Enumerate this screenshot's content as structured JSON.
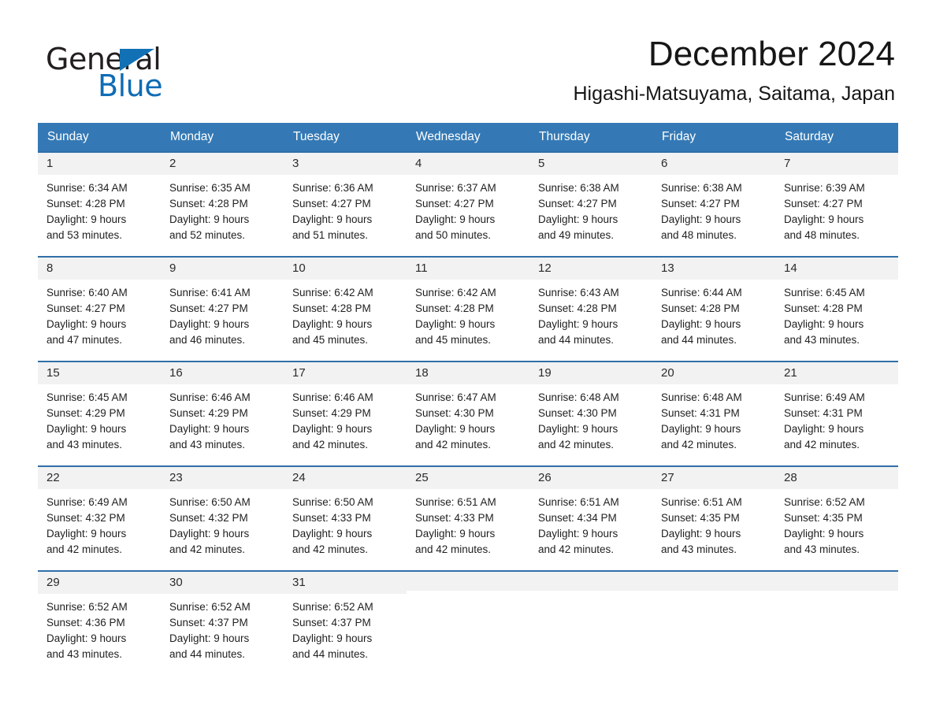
{
  "brand": {
    "name_part1": "General",
    "name_part2": "Blue",
    "triangle_color": "#1271b5",
    "blue_text_color": "#0f6cb5"
  },
  "header": {
    "title": "December 2024",
    "subtitle": "Higashi-Matsuyama, Saitama, Japan"
  },
  "colors": {
    "header_row_bg": "#3479b5",
    "week_divider": "#2f6fa8",
    "day_number_bg": "#f2f2f2"
  },
  "weekdays": [
    "Sunday",
    "Monday",
    "Tuesday",
    "Wednesday",
    "Thursday",
    "Friday",
    "Saturday"
  ],
  "weeks": [
    {
      "days": [
        {
          "num": "1",
          "sunrise": "Sunrise: 6:34 AM",
          "sunset": "Sunset: 4:28 PM",
          "daylight1": "Daylight: 9 hours",
          "daylight2": "and 53 minutes."
        },
        {
          "num": "2",
          "sunrise": "Sunrise: 6:35 AM",
          "sunset": "Sunset: 4:28 PM",
          "daylight1": "Daylight: 9 hours",
          "daylight2": "and 52 minutes."
        },
        {
          "num": "3",
          "sunrise": "Sunrise: 6:36 AM",
          "sunset": "Sunset: 4:27 PM",
          "daylight1": "Daylight: 9 hours",
          "daylight2": "and 51 minutes."
        },
        {
          "num": "4",
          "sunrise": "Sunrise: 6:37 AM",
          "sunset": "Sunset: 4:27 PM",
          "daylight1": "Daylight: 9 hours",
          "daylight2": "and 50 minutes."
        },
        {
          "num": "5",
          "sunrise": "Sunrise: 6:38 AM",
          "sunset": "Sunset: 4:27 PM",
          "daylight1": "Daylight: 9 hours",
          "daylight2": "and 49 minutes."
        },
        {
          "num": "6",
          "sunrise": "Sunrise: 6:38 AM",
          "sunset": "Sunset: 4:27 PM",
          "daylight1": "Daylight: 9 hours",
          "daylight2": "and 48 minutes."
        },
        {
          "num": "7",
          "sunrise": "Sunrise: 6:39 AM",
          "sunset": "Sunset: 4:27 PM",
          "daylight1": "Daylight: 9 hours",
          "daylight2": "and 48 minutes."
        }
      ]
    },
    {
      "days": [
        {
          "num": "8",
          "sunrise": "Sunrise: 6:40 AM",
          "sunset": "Sunset: 4:27 PM",
          "daylight1": "Daylight: 9 hours",
          "daylight2": "and 47 minutes."
        },
        {
          "num": "9",
          "sunrise": "Sunrise: 6:41 AM",
          "sunset": "Sunset: 4:27 PM",
          "daylight1": "Daylight: 9 hours",
          "daylight2": "and 46 minutes."
        },
        {
          "num": "10",
          "sunrise": "Sunrise: 6:42 AM",
          "sunset": "Sunset: 4:28 PM",
          "daylight1": "Daylight: 9 hours",
          "daylight2": "and 45 minutes."
        },
        {
          "num": "11",
          "sunrise": "Sunrise: 6:42 AM",
          "sunset": "Sunset: 4:28 PM",
          "daylight1": "Daylight: 9 hours",
          "daylight2": "and 45 minutes."
        },
        {
          "num": "12",
          "sunrise": "Sunrise: 6:43 AM",
          "sunset": "Sunset: 4:28 PM",
          "daylight1": "Daylight: 9 hours",
          "daylight2": "and 44 minutes."
        },
        {
          "num": "13",
          "sunrise": "Sunrise: 6:44 AM",
          "sunset": "Sunset: 4:28 PM",
          "daylight1": "Daylight: 9 hours",
          "daylight2": "and 44 minutes."
        },
        {
          "num": "14",
          "sunrise": "Sunrise: 6:45 AM",
          "sunset": "Sunset: 4:28 PM",
          "daylight1": "Daylight: 9 hours",
          "daylight2": "and 43 minutes."
        }
      ]
    },
    {
      "days": [
        {
          "num": "15",
          "sunrise": "Sunrise: 6:45 AM",
          "sunset": "Sunset: 4:29 PM",
          "daylight1": "Daylight: 9 hours",
          "daylight2": "and 43 minutes."
        },
        {
          "num": "16",
          "sunrise": "Sunrise: 6:46 AM",
          "sunset": "Sunset: 4:29 PM",
          "daylight1": "Daylight: 9 hours",
          "daylight2": "and 43 minutes."
        },
        {
          "num": "17",
          "sunrise": "Sunrise: 6:46 AM",
          "sunset": "Sunset: 4:29 PM",
          "daylight1": "Daylight: 9 hours",
          "daylight2": "and 42 minutes."
        },
        {
          "num": "18",
          "sunrise": "Sunrise: 6:47 AM",
          "sunset": "Sunset: 4:30 PM",
          "daylight1": "Daylight: 9 hours",
          "daylight2": "and 42 minutes."
        },
        {
          "num": "19",
          "sunrise": "Sunrise: 6:48 AM",
          "sunset": "Sunset: 4:30 PM",
          "daylight1": "Daylight: 9 hours",
          "daylight2": "and 42 minutes."
        },
        {
          "num": "20",
          "sunrise": "Sunrise: 6:48 AM",
          "sunset": "Sunset: 4:31 PM",
          "daylight1": "Daylight: 9 hours",
          "daylight2": "and 42 minutes."
        },
        {
          "num": "21",
          "sunrise": "Sunrise: 6:49 AM",
          "sunset": "Sunset: 4:31 PM",
          "daylight1": "Daylight: 9 hours",
          "daylight2": "and 42 minutes."
        }
      ]
    },
    {
      "days": [
        {
          "num": "22",
          "sunrise": "Sunrise: 6:49 AM",
          "sunset": "Sunset: 4:32 PM",
          "daylight1": "Daylight: 9 hours",
          "daylight2": "and 42 minutes."
        },
        {
          "num": "23",
          "sunrise": "Sunrise: 6:50 AM",
          "sunset": "Sunset: 4:32 PM",
          "daylight1": "Daylight: 9 hours",
          "daylight2": "and 42 minutes."
        },
        {
          "num": "24",
          "sunrise": "Sunrise: 6:50 AM",
          "sunset": "Sunset: 4:33 PM",
          "daylight1": "Daylight: 9 hours",
          "daylight2": "and 42 minutes."
        },
        {
          "num": "25",
          "sunrise": "Sunrise: 6:51 AM",
          "sunset": "Sunset: 4:33 PM",
          "daylight1": "Daylight: 9 hours",
          "daylight2": "and 42 minutes."
        },
        {
          "num": "26",
          "sunrise": "Sunrise: 6:51 AM",
          "sunset": "Sunset: 4:34 PM",
          "daylight1": "Daylight: 9 hours",
          "daylight2": "and 42 minutes."
        },
        {
          "num": "27",
          "sunrise": "Sunrise: 6:51 AM",
          "sunset": "Sunset: 4:35 PM",
          "daylight1": "Daylight: 9 hours",
          "daylight2": "and 43 minutes."
        },
        {
          "num": "28",
          "sunrise": "Sunrise: 6:52 AM",
          "sunset": "Sunset: 4:35 PM",
          "daylight1": "Daylight: 9 hours",
          "daylight2": "and 43 minutes."
        }
      ]
    },
    {
      "days": [
        {
          "num": "29",
          "sunrise": "Sunrise: 6:52 AM",
          "sunset": "Sunset: 4:36 PM",
          "daylight1": "Daylight: 9 hours",
          "daylight2": "and 43 minutes."
        },
        {
          "num": "30",
          "sunrise": "Sunrise: 6:52 AM",
          "sunset": "Sunset: 4:37 PM",
          "daylight1": "Daylight: 9 hours",
          "daylight2": "and 44 minutes."
        },
        {
          "num": "31",
          "sunrise": "Sunrise: 6:52 AM",
          "sunset": "Sunset: 4:37 PM",
          "daylight1": "Daylight: 9 hours",
          "daylight2": "and 44 minutes."
        },
        {
          "num": "",
          "sunrise": "",
          "sunset": "",
          "daylight1": "",
          "daylight2": ""
        },
        {
          "num": "",
          "sunrise": "",
          "sunset": "",
          "daylight1": "",
          "daylight2": ""
        },
        {
          "num": "",
          "sunrise": "",
          "sunset": "",
          "daylight1": "",
          "daylight2": ""
        },
        {
          "num": "",
          "sunrise": "",
          "sunset": "",
          "daylight1": "",
          "daylight2": ""
        }
      ]
    }
  ]
}
